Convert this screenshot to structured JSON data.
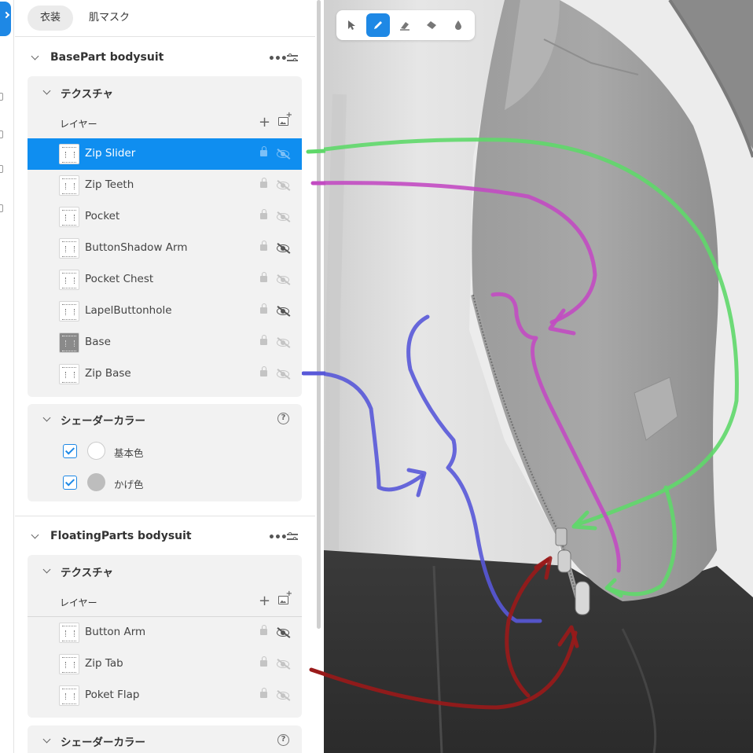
{
  "tabs": [
    "衣装",
    "肌マスク"
  ],
  "sections": [
    {
      "title": "BasePart bodysuit",
      "texture_title": "テクスチャ",
      "layer_label": "レイヤー",
      "layers": [
        {
          "name": "Zip Slider",
          "selected": true,
          "hidden_icon_dark": false
        },
        {
          "name": "Zip Teeth",
          "selected": false,
          "hidden_icon_dark": false
        },
        {
          "name": "Pocket",
          "selected": false,
          "hidden_icon_dark": false
        },
        {
          "name": "ButtonShadow Arm",
          "selected": false,
          "hidden_icon_dark": true
        },
        {
          "name": "Pocket Chest",
          "selected": false,
          "hidden_icon_dark": false
        },
        {
          "name": "LapelButtonhole",
          "selected": false,
          "hidden_icon_dark": true
        },
        {
          "name": "Base",
          "selected": false,
          "hidden_icon_dark": false
        },
        {
          "name": "Zip Base",
          "selected": false,
          "hidden_icon_dark": false
        }
      ],
      "shader_title": "シェーダーカラー",
      "shader_colors": [
        {
          "label": "基本色",
          "checked": true,
          "color": "#ffffff"
        },
        {
          "label": "かげ色",
          "checked": true,
          "color": "#bdbdbd"
        }
      ]
    },
    {
      "title": "FloatingParts bodysuit",
      "texture_title": "テクスチャ",
      "layer_label": "レイヤー",
      "layers": [
        {
          "name": "Button Arm",
          "selected": false,
          "hidden_icon_dark": true
        },
        {
          "name": "Zip Tab",
          "selected": false,
          "hidden_icon_dark": false
        },
        {
          "name": "Poket Flap",
          "selected": false,
          "hidden_icon_dark": false
        }
      ],
      "shader_title": "シェーダーカラー"
    }
  ],
  "tools": [
    "select-tool",
    "brush-tool",
    "eraser-tool",
    "fill-eraser-tool",
    "dropper-tool"
  ],
  "active_tool": "brush-tool",
  "colors": {
    "accent": "#1e88e5",
    "selection": "#0f8ef0",
    "arrow_green": "#5fd86a",
    "arrow_magenta": "#c24bc2",
    "arrow_blue": "#5858d8",
    "arrow_red": "#9a1a1a"
  }
}
